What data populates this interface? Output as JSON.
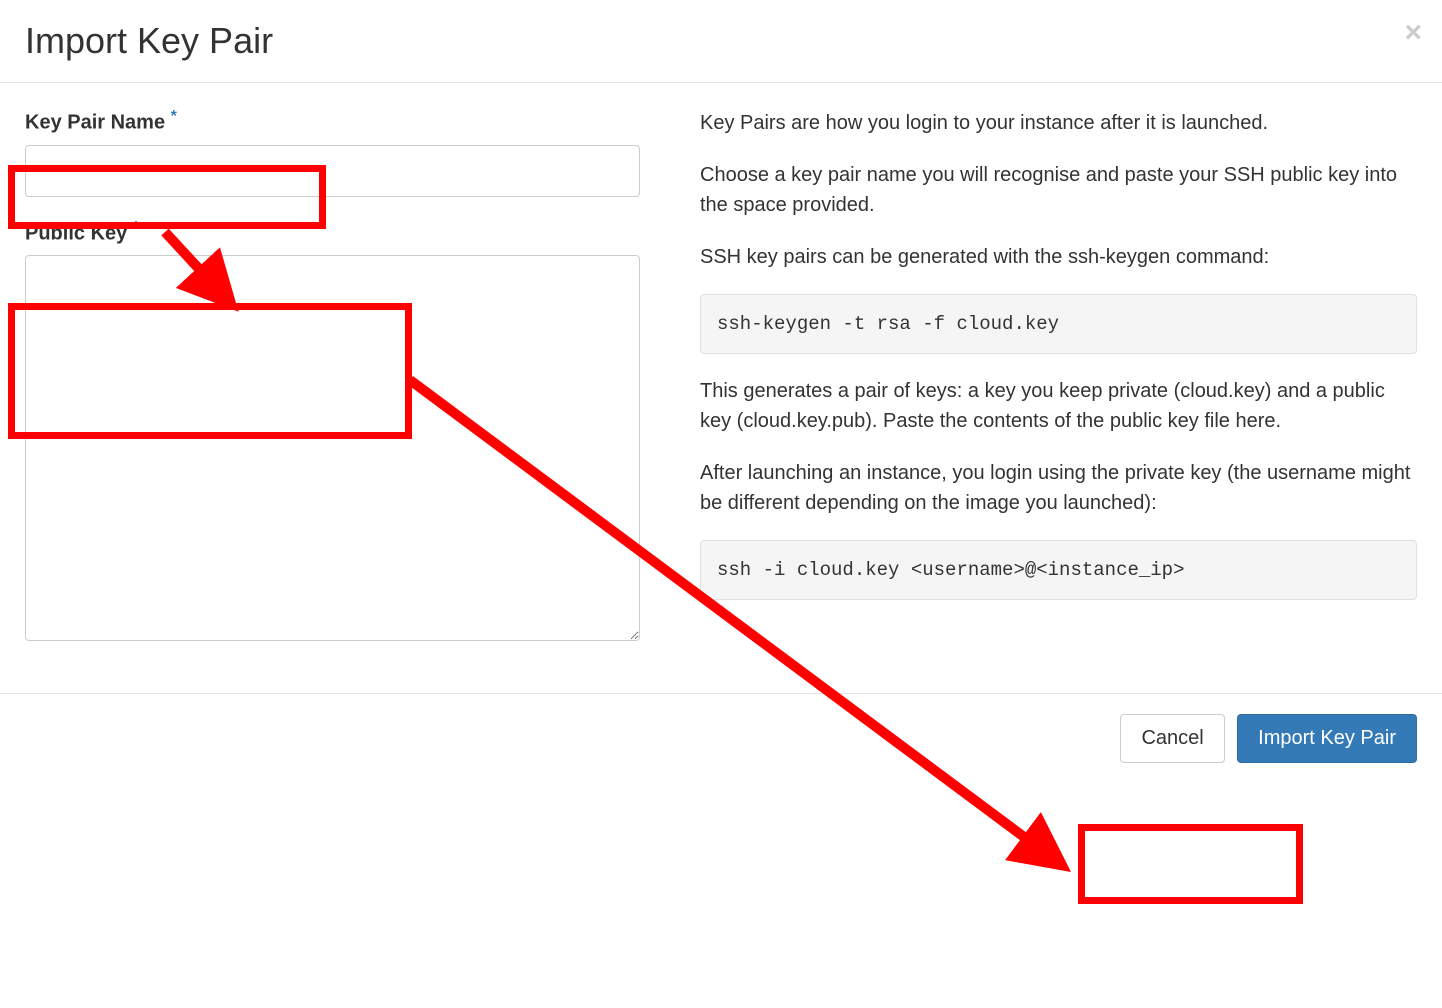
{
  "header": {
    "title": "Import Key Pair"
  },
  "form": {
    "keyPairName": {
      "label": "Key Pair Name",
      "value": ""
    },
    "publicKey": {
      "label": "Public Key",
      "value": ""
    },
    "requiredMark": "*"
  },
  "help": {
    "p1": "Key Pairs are how you login to your instance after it is launched.",
    "p2": "Choose a key pair name you will recognise and paste your SSH public key into the space provided.",
    "p3": "SSH key pairs can be generated with the ssh-keygen command:",
    "code1": "ssh-keygen -t rsa -f cloud.key",
    "p4": "This generates a pair of keys: a key you keep private (cloud.key) and a public key (cloud.key.pub). Paste the contents of the public key file here.",
    "p5": "After launching an instance, you login using the private key (the username might be different depending on the image you launched):",
    "code2": "ssh -i cloud.key <username>@<instance_ip>"
  },
  "footer": {
    "cancel": "Cancel",
    "submit": "Import Key Pair"
  }
}
